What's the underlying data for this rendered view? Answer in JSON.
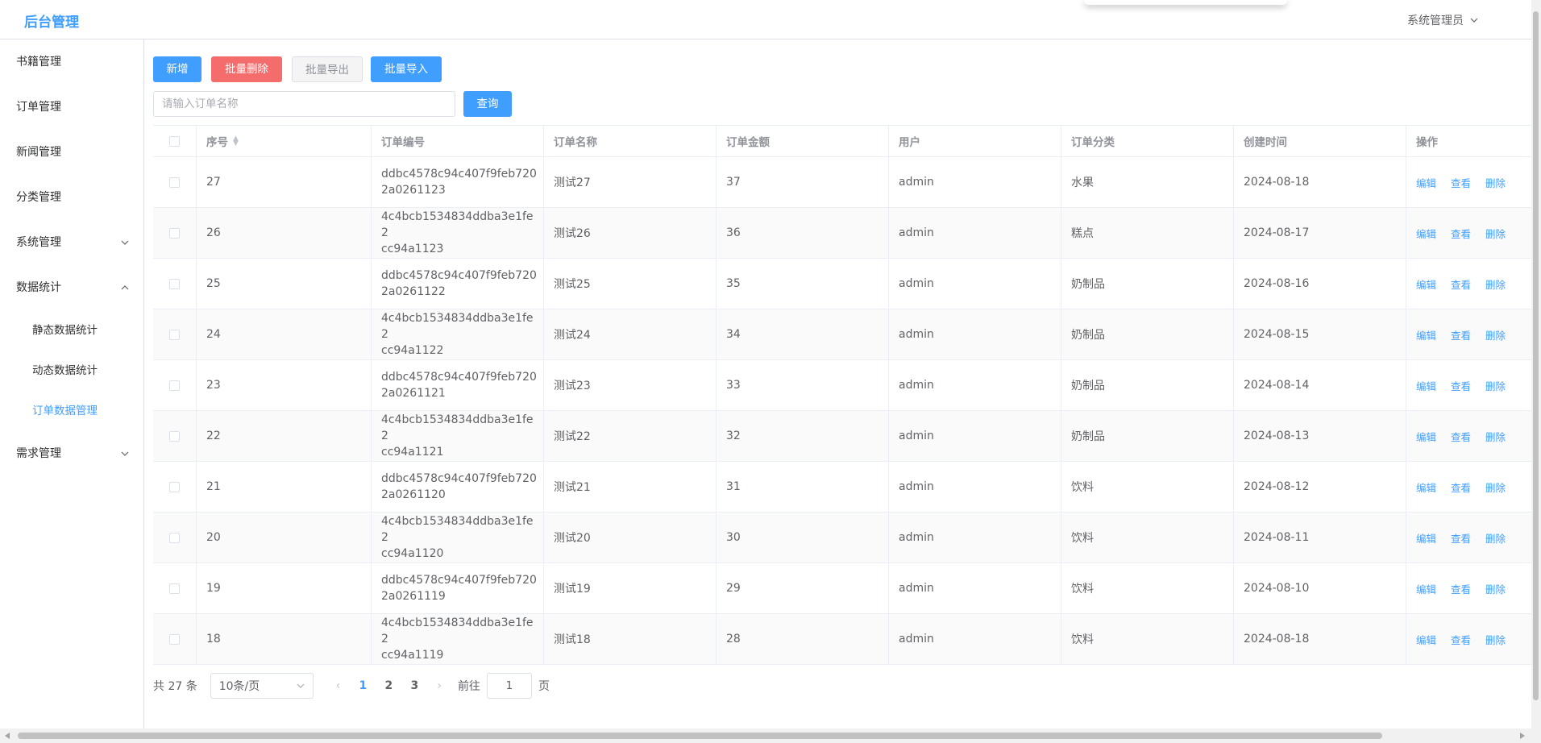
{
  "header": {
    "title": "后台管理",
    "user": "系统管理员"
  },
  "sidebar": {
    "items": [
      {
        "label": "书籍管理"
      },
      {
        "label": "订单管理"
      },
      {
        "label": "新闻管理"
      },
      {
        "label": "分类管理"
      },
      {
        "label": "系统管理"
      },
      {
        "label": "数据统计"
      },
      {
        "label": "静态数据统计"
      },
      {
        "label": "动态数据统计"
      },
      {
        "label": "订单数据管理"
      },
      {
        "label": "需求管理"
      }
    ]
  },
  "toolbar": {
    "add": "新增",
    "batch_delete": "批量删除",
    "batch_export": "批量导出",
    "batch_import": "批量导入",
    "search_placeholder": "请输入订单名称",
    "search": "查询"
  },
  "table": {
    "columns": [
      "序号",
      "订单编号",
      "订单名称",
      "订单金额",
      "用户",
      "订单分类",
      "创建时间",
      "操作"
    ],
    "actions": {
      "edit": "编辑",
      "view": "查看",
      "delete": "删除"
    },
    "rows": [
      {
        "id": "27",
        "code": "ddbc4578c94c407f9feb720\n2a0261123",
        "name": "测试27",
        "amount": "37",
        "user": "admin",
        "category": "水果",
        "date": "2024-08-18"
      },
      {
        "id": "26",
        "code": "4c4bcb1534834ddba3e1fe2\ncc94a1123",
        "name": "测试26",
        "amount": "36",
        "user": "admin",
        "category": "糕点",
        "date": "2024-08-17"
      },
      {
        "id": "25",
        "code": "ddbc4578c94c407f9feb720\n2a0261122",
        "name": "测试25",
        "amount": "35",
        "user": "admin",
        "category": "奶制品",
        "date": "2024-08-16"
      },
      {
        "id": "24",
        "code": "4c4bcb1534834ddba3e1fe2\ncc94a1122",
        "name": "测试24",
        "amount": "34",
        "user": "admin",
        "category": "奶制品",
        "date": "2024-08-15"
      },
      {
        "id": "23",
        "code": "ddbc4578c94c407f9feb720\n2a0261121",
        "name": "测试23",
        "amount": "33",
        "user": "admin",
        "category": "奶制品",
        "date": "2024-08-14"
      },
      {
        "id": "22",
        "code": "4c4bcb1534834ddba3e1fe2\ncc94a1121",
        "name": "测试22",
        "amount": "32",
        "user": "admin",
        "category": "奶制品",
        "date": "2024-08-13"
      },
      {
        "id": "21",
        "code": "ddbc4578c94c407f9feb720\n2a0261120",
        "name": "测试21",
        "amount": "31",
        "user": "admin",
        "category": "饮料",
        "date": "2024-08-12"
      },
      {
        "id": "20",
        "code": "4c4bcb1534834ddba3e1fe2\ncc94a1120",
        "name": "测试20",
        "amount": "30",
        "user": "admin",
        "category": "饮料",
        "date": "2024-08-11"
      },
      {
        "id": "19",
        "code": "ddbc4578c94c407f9feb720\n2a0261119",
        "name": "测试19",
        "amount": "29",
        "user": "admin",
        "category": "饮料",
        "date": "2024-08-10"
      },
      {
        "id": "18",
        "code": "4c4bcb1534834ddba3e1fe2\ncc94a1119",
        "name": "测试18",
        "amount": "28",
        "user": "admin",
        "category": "饮料",
        "date": "2024-08-18"
      }
    ]
  },
  "pagination": {
    "total": "共 27 条",
    "page_size": "10条/页",
    "pages": [
      "1",
      "2",
      "3"
    ],
    "current_page": "1",
    "goto_label": "前往",
    "goto_value": "1",
    "page_suffix": "页"
  },
  "colors": {
    "primary": "#409eff",
    "danger": "#f56c6c",
    "border": "#dcdfe6"
  }
}
